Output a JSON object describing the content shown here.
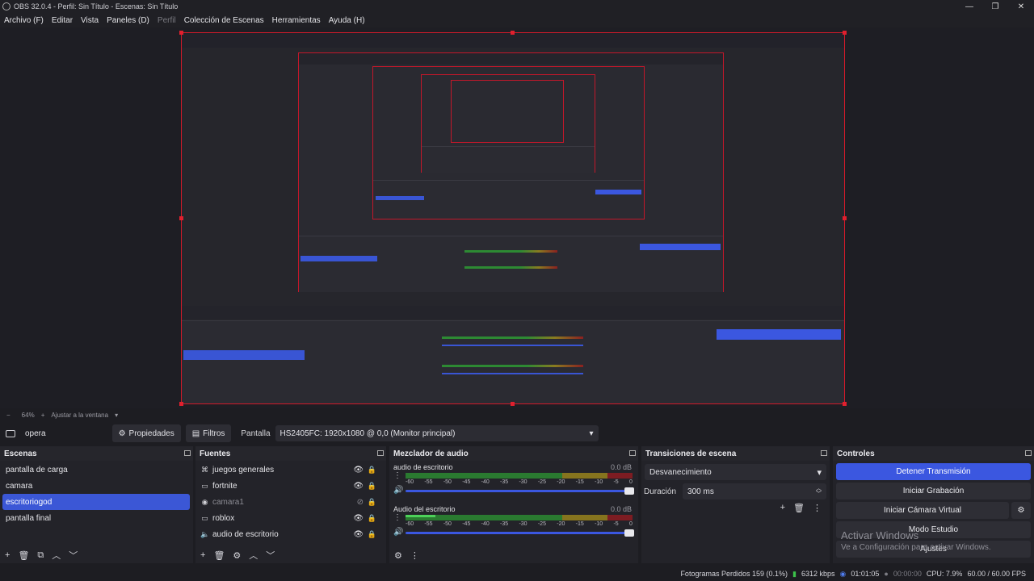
{
  "window": {
    "title": "OBS 32.0.4 - Perfil: Sin Título - Escenas: Sin Título",
    "controls": [
      "—",
      "❐",
      "✕"
    ]
  },
  "menu": [
    "Archivo (F)",
    "Editar",
    "Vista",
    "Paneles (D)",
    "Perfil",
    "Colección de Escenas",
    "Herramientas",
    "Ayuda (H)"
  ],
  "zoom": {
    "minus": "−",
    "percent": "64%",
    "plus": "+",
    "fit": "Ajustar a la ventana",
    "arrow": "▾"
  },
  "source_toolbar": {
    "source_name": "opera",
    "properties_label": "Propiedades",
    "filters_label": "Filtros",
    "display_label": "Pantalla",
    "display_value": "HS2405FC: 1920x1080 @ 0,0 (Monitor principal)"
  },
  "scenes": {
    "title": "Escenas",
    "items": [
      "pantalla de carga",
      "camara",
      "escritoriogod",
      "pantalla final"
    ],
    "selected_index": 2,
    "footer": [
      "+",
      "🗑",
      "⧉",
      "︿",
      "﹀"
    ]
  },
  "sources": {
    "title": "Fuentes",
    "items": [
      {
        "name": "juegos generales",
        "icon": "gamepad-icon",
        "glyph": "⌘",
        "visible": true,
        "eye": "👁",
        "lock": "🔒"
      },
      {
        "name": "fortnite",
        "icon": "window-icon",
        "glyph": "▭",
        "visible": true,
        "eye": "👁",
        "lock": "🔒"
      },
      {
        "name": "camara1",
        "icon": "camera-icon",
        "glyph": "◉",
        "visible": false,
        "eye": "⊘",
        "lock": "🔒"
      },
      {
        "name": "roblox",
        "icon": "window-icon",
        "glyph": "▭",
        "visible": true,
        "eye": "👁",
        "lock": "🔒"
      },
      {
        "name": "audio de escritorio",
        "icon": "speaker-icon",
        "glyph": "🔈",
        "visible": true,
        "eye": "👁",
        "lock": "🔒"
      }
    ],
    "footer": [
      "+",
      "🗑",
      "⚙",
      "︿",
      "﹀"
    ]
  },
  "mixer": {
    "title": "Mezclador de audio",
    "ticks": [
      "-60",
      "-55",
      "-50",
      "-45",
      "-40",
      "-35",
      "-30",
      "-25",
      "-20",
      "-15",
      "-10",
      "-5",
      "0"
    ],
    "channels": [
      {
        "name": "audio de escritorio",
        "db": "0.0 dB",
        "level": 0.0,
        "volume": 1.0
      },
      {
        "name": "Audio del escritorio",
        "db": "0.0 dB",
        "level": 0.13,
        "volume": 1.0
      }
    ],
    "footer": [
      "⚙",
      "⋮"
    ]
  },
  "transitions": {
    "title": "Transiciones de escena",
    "selected": "Desvanecimiento",
    "duration_label": "Duración",
    "duration_value": "300 ms",
    "buttons": [
      "+",
      "🗑",
      "⋮"
    ]
  },
  "controls": {
    "title": "Controles",
    "stop_stream": "Detener Transmisión",
    "start_recording": "Iniciar Grabación",
    "virtual_camera": "Iniciar Cámara Virtual",
    "studio_mode": "Modo Estudio",
    "settings": "Ajustes"
  },
  "watermark": {
    "title": "Activar Windows",
    "subtitle": "Ve a Configuración para activar Windows."
  },
  "status": {
    "dropped_frames": "Fotogramas Perdidos 159 (0.1%)",
    "bitrate": "6312 kbps",
    "stream_time": "01:01:05",
    "rec_time": "00:00:00",
    "cpu": "CPU: 7.9%",
    "fps": "60.00 / 60.00 FPS"
  },
  "colors": {
    "accent": "#3b57e0",
    "selection": "#3b57d6",
    "preview_border": "#d11a2a",
    "meter_green": "#2a7a30"
  }
}
